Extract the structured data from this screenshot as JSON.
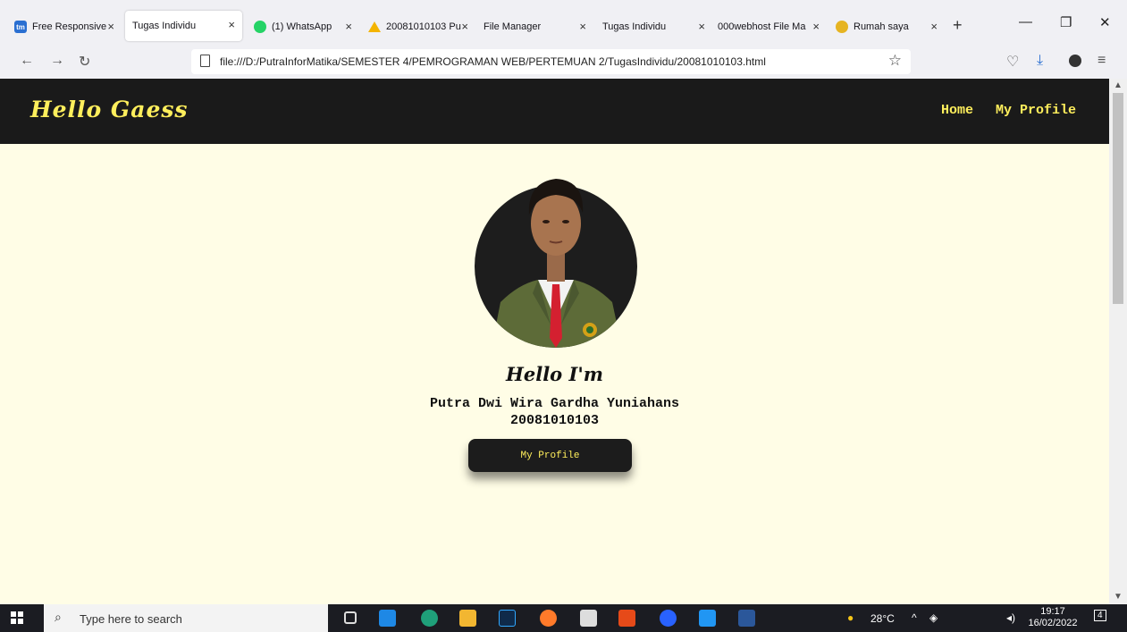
{
  "browser": {
    "tabs": [
      {
        "title": "Free Responsive",
        "favicon": "tm-icon",
        "active": false
      },
      {
        "title": "Tugas Individu",
        "favicon": "none",
        "active": true
      },
      {
        "title": "(1) WhatsApp",
        "favicon": "whatsapp-icon",
        "active": false
      },
      {
        "title": "20081010103 Pu",
        "favicon": "google-drive-icon",
        "active": false
      },
      {
        "title": "File Manager",
        "favicon": "none",
        "active": false
      },
      {
        "title": "Tugas Individu",
        "favicon": "none",
        "active": false
      },
      {
        "title": "000webhost File Ma",
        "favicon": "none",
        "active": false
      },
      {
        "title": "Rumah saya",
        "favicon": "rumah-icon",
        "active": false
      }
    ],
    "tm_favicon_text": "tm",
    "url": "file:///D:/PutraInforMatika/SEMESTER 4/PEMROGRAMAN WEB/PERTEMUAN 2/TugasIndividu/20081010103.html"
  },
  "site": {
    "brand": "Hello Gaess",
    "menu": [
      "Home",
      "My Profile"
    ],
    "hero": {
      "greeting": "Hello I'm",
      "name": "Putra Dwi Wira Gardha Yuniahans",
      "nim": "20081010103",
      "button": "My Profile"
    }
  },
  "taskbar": {
    "search_placeholder": "Type here to search",
    "weather": "28°C",
    "time": "19:17",
    "date": "16/02/2022",
    "notification_count": "4"
  },
  "colors": {
    "accent_yellow": "#ffef5c",
    "header_bg": "#1a1a1a",
    "page_bg": "#fffde6"
  }
}
